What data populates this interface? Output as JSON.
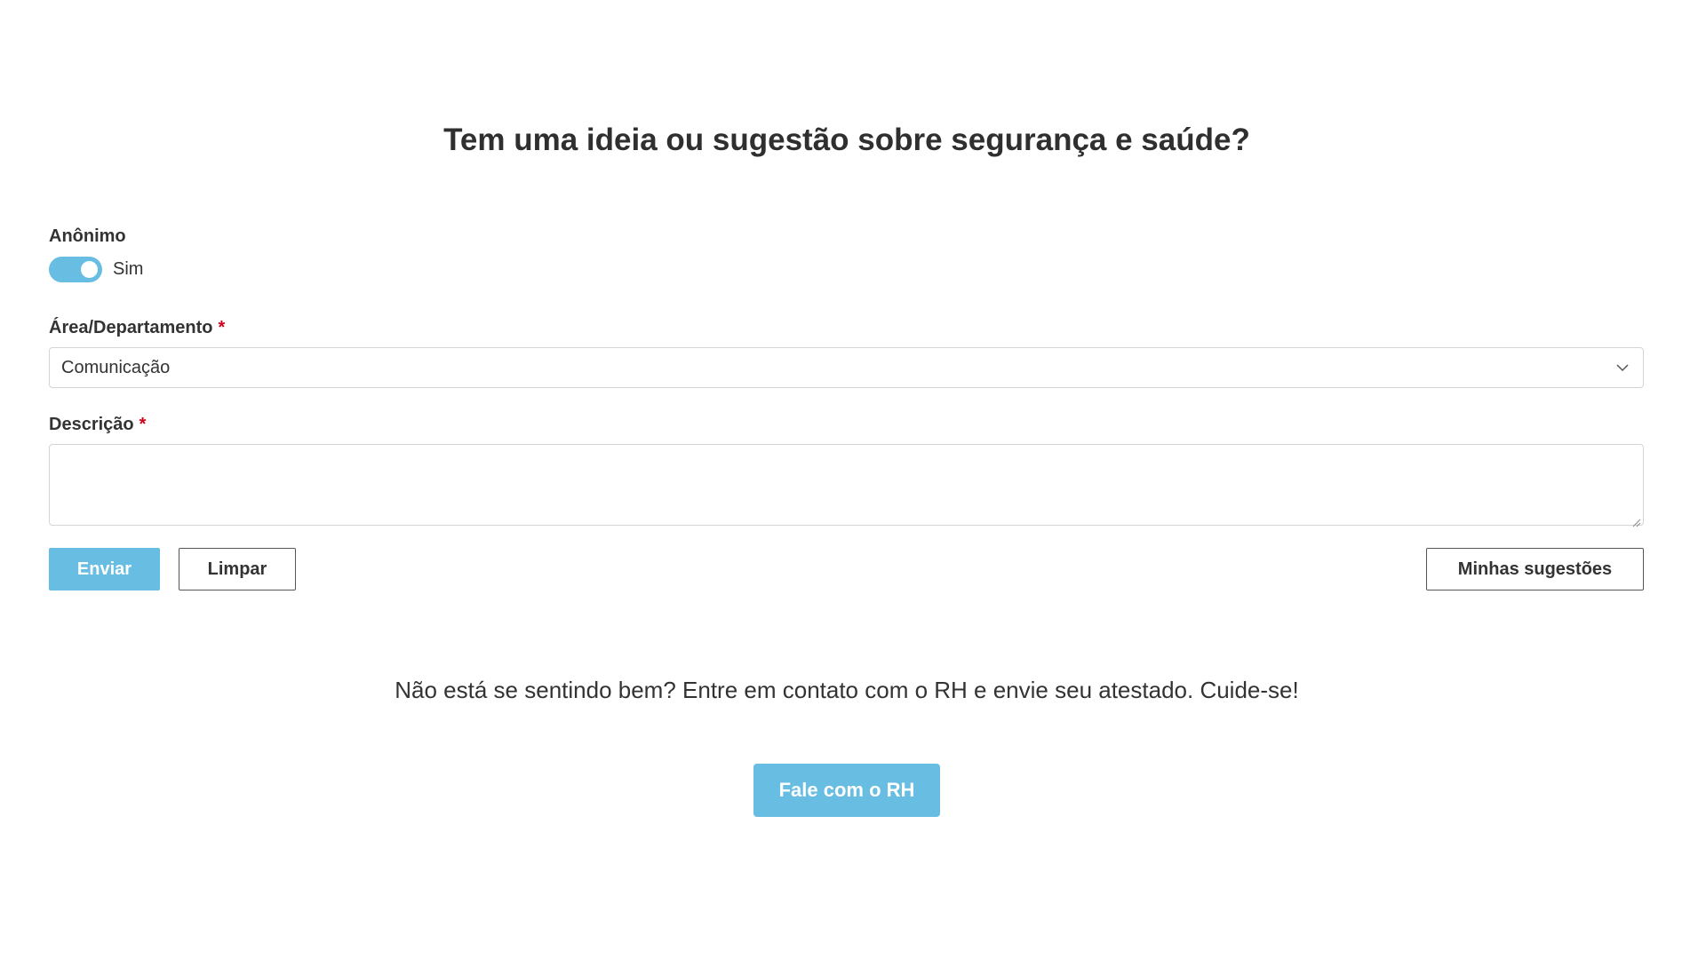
{
  "page": {
    "title": "Tem uma ideia ou sugestão sobre segurança e saúde?"
  },
  "form": {
    "anonymous": {
      "label": "Anônimo",
      "toggle_on": true,
      "toggle_text": "Sim"
    },
    "area": {
      "label": "Área/Departamento",
      "required_mark": "*",
      "selected_value": "Comunicação"
    },
    "description": {
      "label": "Descrição",
      "required_mark": "*",
      "value": ""
    },
    "buttons": {
      "submit_label": "Enviar",
      "clear_label": "Limpar",
      "my_suggestions_label": "Minhas sugestões"
    }
  },
  "footer": {
    "message": "Não está se sentindo bem? Entre em contato com o RH e envie seu atestado. Cuide-se!",
    "contact_hr_label": "Fale com o RH"
  },
  "colors": {
    "accent": "#68bde2",
    "required": "#d0021b",
    "text": "#333333",
    "border": "#d4d4d4"
  },
  "icons": {
    "select_arrow": "chevron-down-icon",
    "textarea_resize": "resize-handle-icon"
  }
}
